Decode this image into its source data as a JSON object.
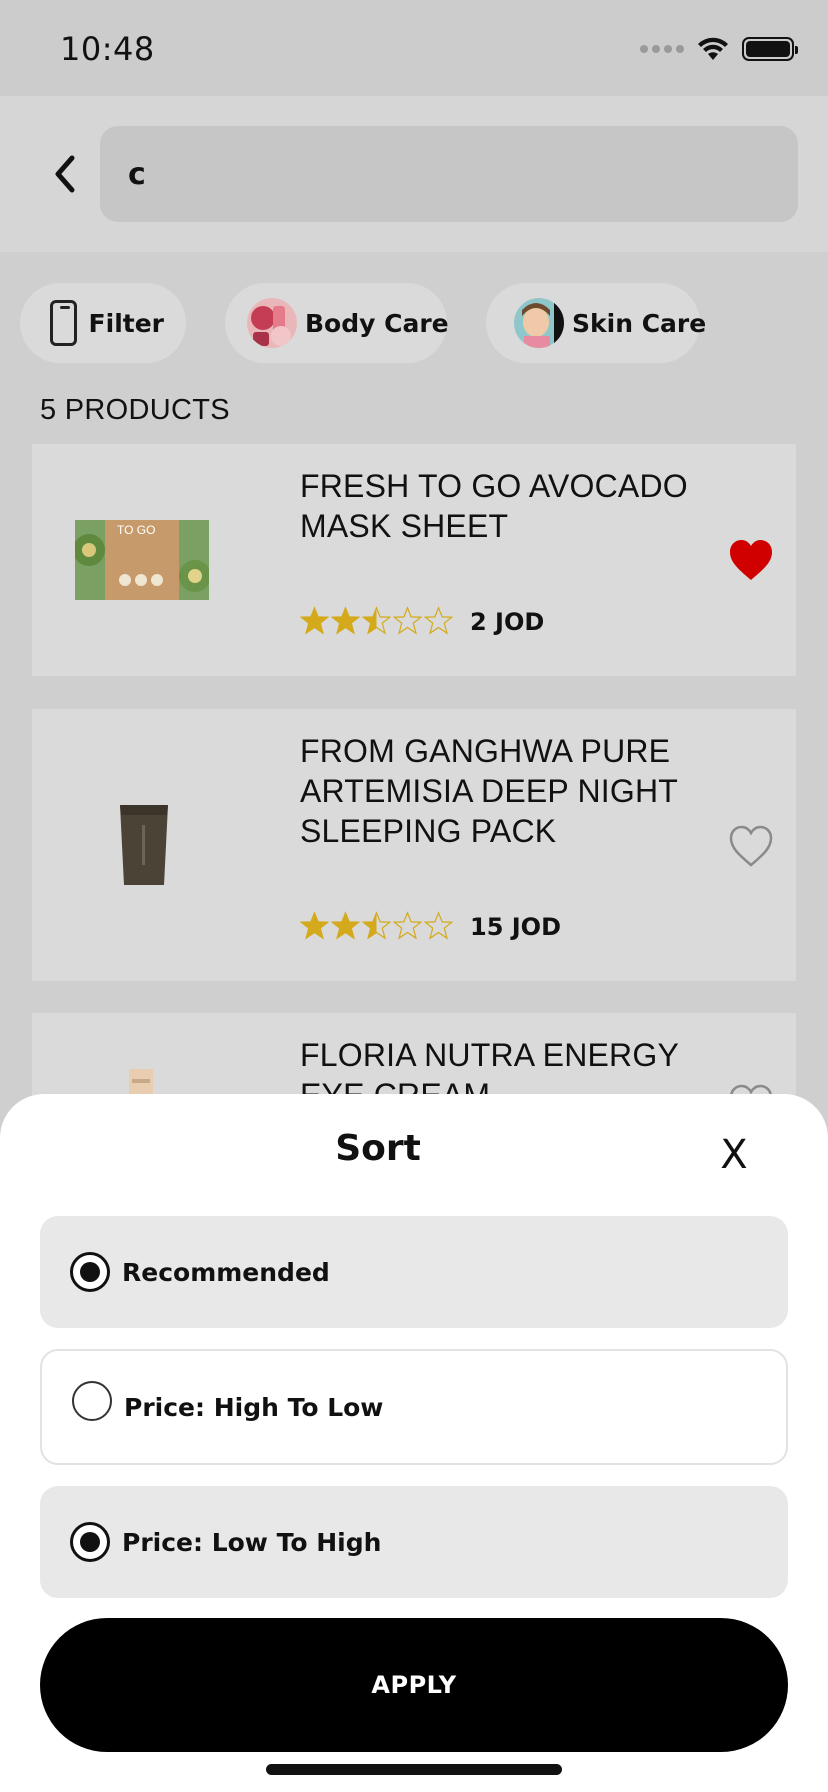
{
  "status_bar": {
    "time": "10:48",
    "icons": [
      "signal-dots-icon",
      "wifi-icon",
      "battery-icon"
    ]
  },
  "search": {
    "value": "c",
    "back_icon": "chevron-left-icon"
  },
  "chips": [
    {
      "label": "Filter",
      "icon": "phone-icon"
    },
    {
      "label": "Body Care",
      "icon": "body-care-thumbnail"
    },
    {
      "label": "Skin Care",
      "icon": "skin-care-thumbnail"
    }
  ],
  "results": {
    "count_label": "5 PRODUCTS"
  },
  "products": [
    {
      "title": "FRESH TO GO AVOCADO MASK SHEET",
      "thumb_text": "TO GO",
      "rating": 2.5,
      "price": "2 JOD",
      "favorited": true
    },
    {
      "title": "FROM GANGHWA PURE ARTEMISIA DEEP NIGHT SLEEPING PACK",
      "rating": 2.5,
      "price": "15 JOD",
      "favorited": false
    },
    {
      "title": "FLORIA NUTRA ENERGY EYE CREAM",
      "favorited": false
    }
  ],
  "sort_sheet": {
    "title": "Sort",
    "close_label": "X",
    "options": [
      {
        "label": "Recommended",
        "selected": true
      },
      {
        "label": "Price: High To Low",
        "selected": false
      },
      {
        "label": "Price: Low To High",
        "selected": true
      }
    ],
    "apply_label": "APPLY"
  },
  "colors": {
    "star": "#d4aa1c",
    "heart_active": "#d00000",
    "overlay_background": "#cfcfcf",
    "button": "#000000"
  }
}
